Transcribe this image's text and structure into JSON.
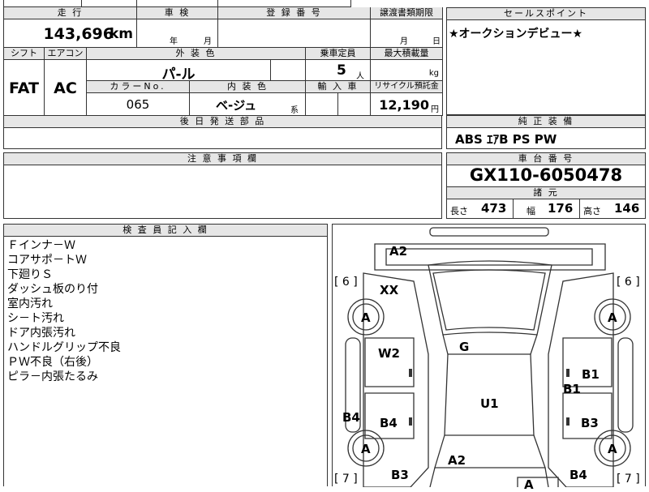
{
  "top": {
    "mileage_label": "走 行",
    "mileage_value": "143,696",
    "mileage_unit": "km",
    "inspection_label": "車 検",
    "year_unit": "年",
    "month_unit": "月",
    "registration_label": "登 録 番 号",
    "transfer_label": "譲渡書類期限",
    "transfer_month": "月",
    "transfer_day": "日"
  },
  "spec": {
    "shift_label": "シフト",
    "shift_value": "FAT",
    "aircon_label": "エアコン",
    "aircon_value": "AC",
    "exterior_label": "外 装 色",
    "exterior_value": "パ-ル",
    "capacity_label": "乗車定員",
    "capacity_value": "5",
    "capacity_unit": "人",
    "load_label": "最大積載量",
    "load_unit": "kg",
    "color_no_label": "カラーNo.",
    "color_no_value": "065",
    "interior_label": "内 装 色",
    "interior_value": "ベ-ジュ",
    "interior_suffix": "系",
    "import_label": "輸 入 車",
    "recycle_label": "リサイクル預託金",
    "recycle_value": "12,190",
    "recycle_unit": "円"
  },
  "later_parts_label": "後 日 発 送 部 品",
  "notes_label": "注 意 事 項 欄",
  "sales": {
    "label": "セールスポイント",
    "text": "★オークションデビュー★"
  },
  "equipment": {
    "label": "純 正 装 備",
    "value": "ABS ｴｱB PS PW"
  },
  "chassis": {
    "label": "車 台 番 号",
    "value": "GX110-6050478"
  },
  "dims": {
    "label": "諸 元",
    "length_label": "長さ",
    "length_value": "473",
    "width_label": "幅",
    "width_value": "176",
    "height_label": "高さ",
    "height_value": "146"
  },
  "inspector": {
    "label": "検 査 員 記 入 欄",
    "lines": [
      "Ｆインナ－Ｗ",
      "コアサポ－トＷ",
      "下廻りＳ",
      "ダッシュ板のり付",
      "室内汚れ",
      "シ－ト汚れ",
      "ドア内張汚れ",
      "ハンドルグリップ不良",
      "ＰＷ不良（右後）",
      "ピラ－内張たるみ"
    ]
  },
  "diagram": {
    "tire_fl": "6",
    "tire_fr": "6",
    "tire_rl": "7",
    "tire_rr": "7",
    "marks": {
      "a2_front": "A2",
      "xx": "XX",
      "wheel_fl": "A",
      "wheel_fr": "A",
      "w2": "W2",
      "g": "G",
      "b1a": "B1",
      "b1b": "B1",
      "u1": "U1",
      "b4_left": "B4",
      "b4_door": "B4",
      "b3_right": "B3",
      "wheel_rl": "A",
      "wheel_rr": "A",
      "a2_rear": "A2",
      "b3_rear": "B3",
      "b4_rear": "B4",
      "a_rear": "A"
    }
  }
}
